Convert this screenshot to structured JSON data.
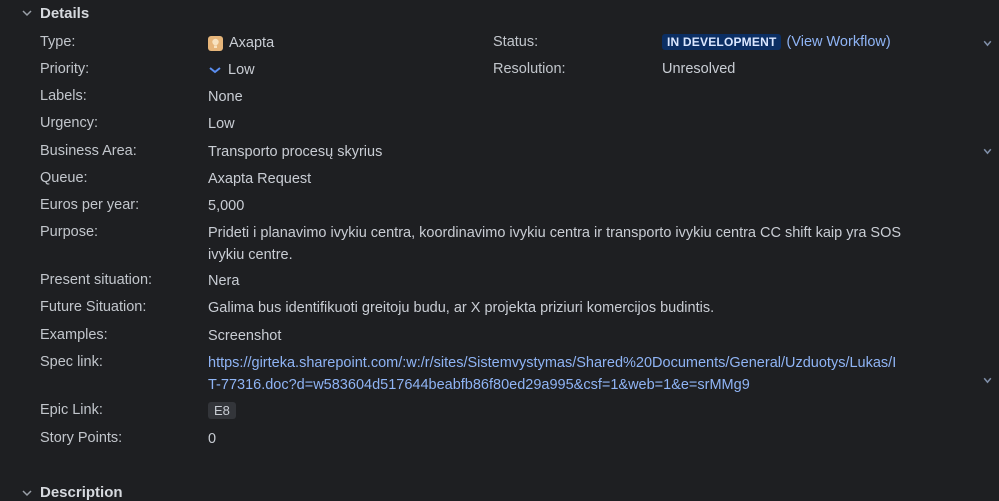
{
  "details": {
    "title": "Details",
    "fields": {
      "type": {
        "label": "Type:",
        "value": "Axapta"
      },
      "priority": {
        "label": "Priority:",
        "value": "Low"
      },
      "labels": {
        "label": "Labels:",
        "value": "None"
      },
      "urgency": {
        "label": "Urgency:",
        "value": "Low"
      },
      "business_area": {
        "label": "Business Area:",
        "value": "Transporto procesų skyrius"
      },
      "queue": {
        "label": "Queue:",
        "value": "Axapta Request"
      },
      "euros": {
        "label": "Euros per year:",
        "value": "5,000"
      },
      "purpose": {
        "label": "Purpose:",
        "value": "Prideti i planavimo ivykiu centra, koordinavimo ivykiu centra ir transporto ivykiu centra CC shift kaip yra SOS ivykiu centre."
      },
      "present": {
        "label": "Present situation:",
        "value": "Nera"
      },
      "future": {
        "label": "Future Situation:",
        "value": "Galima bus identifikuoti greitoju budu, ar X projekta priziuri komercijos budintis."
      },
      "examples": {
        "label": "Examples:",
        "value": "Screenshot"
      },
      "spec_link": {
        "label": "Spec link:",
        "value": "https://girteka.sharepoint.com/:w:/r/sites/Sistemvystymas/Shared%20Documents/General/Uzduotys/Lukas/IT-77316.doc?d=w583604d517644beabfb86f80ed29a995&csf=1&web=1&e=srMMg9"
      },
      "epic_link": {
        "label": "Epic Link:",
        "value": "E8"
      },
      "story_points": {
        "label": "Story Points:",
        "value": "0"
      },
      "status": {
        "label": "Status:",
        "value": "IN DEVELOPMENT",
        "workflow_link": "(View Workflow)"
      },
      "resolution": {
        "label": "Resolution:",
        "value": "Unresolved"
      }
    }
  },
  "description": {
    "title": "Description"
  },
  "colors": {
    "background": "#1e1f22",
    "link": "#8fb4f5",
    "badge": "#0b2e63"
  },
  "icons": [
    "chevron-down-icon",
    "axapta-type-icon",
    "low-priority-icon"
  ]
}
